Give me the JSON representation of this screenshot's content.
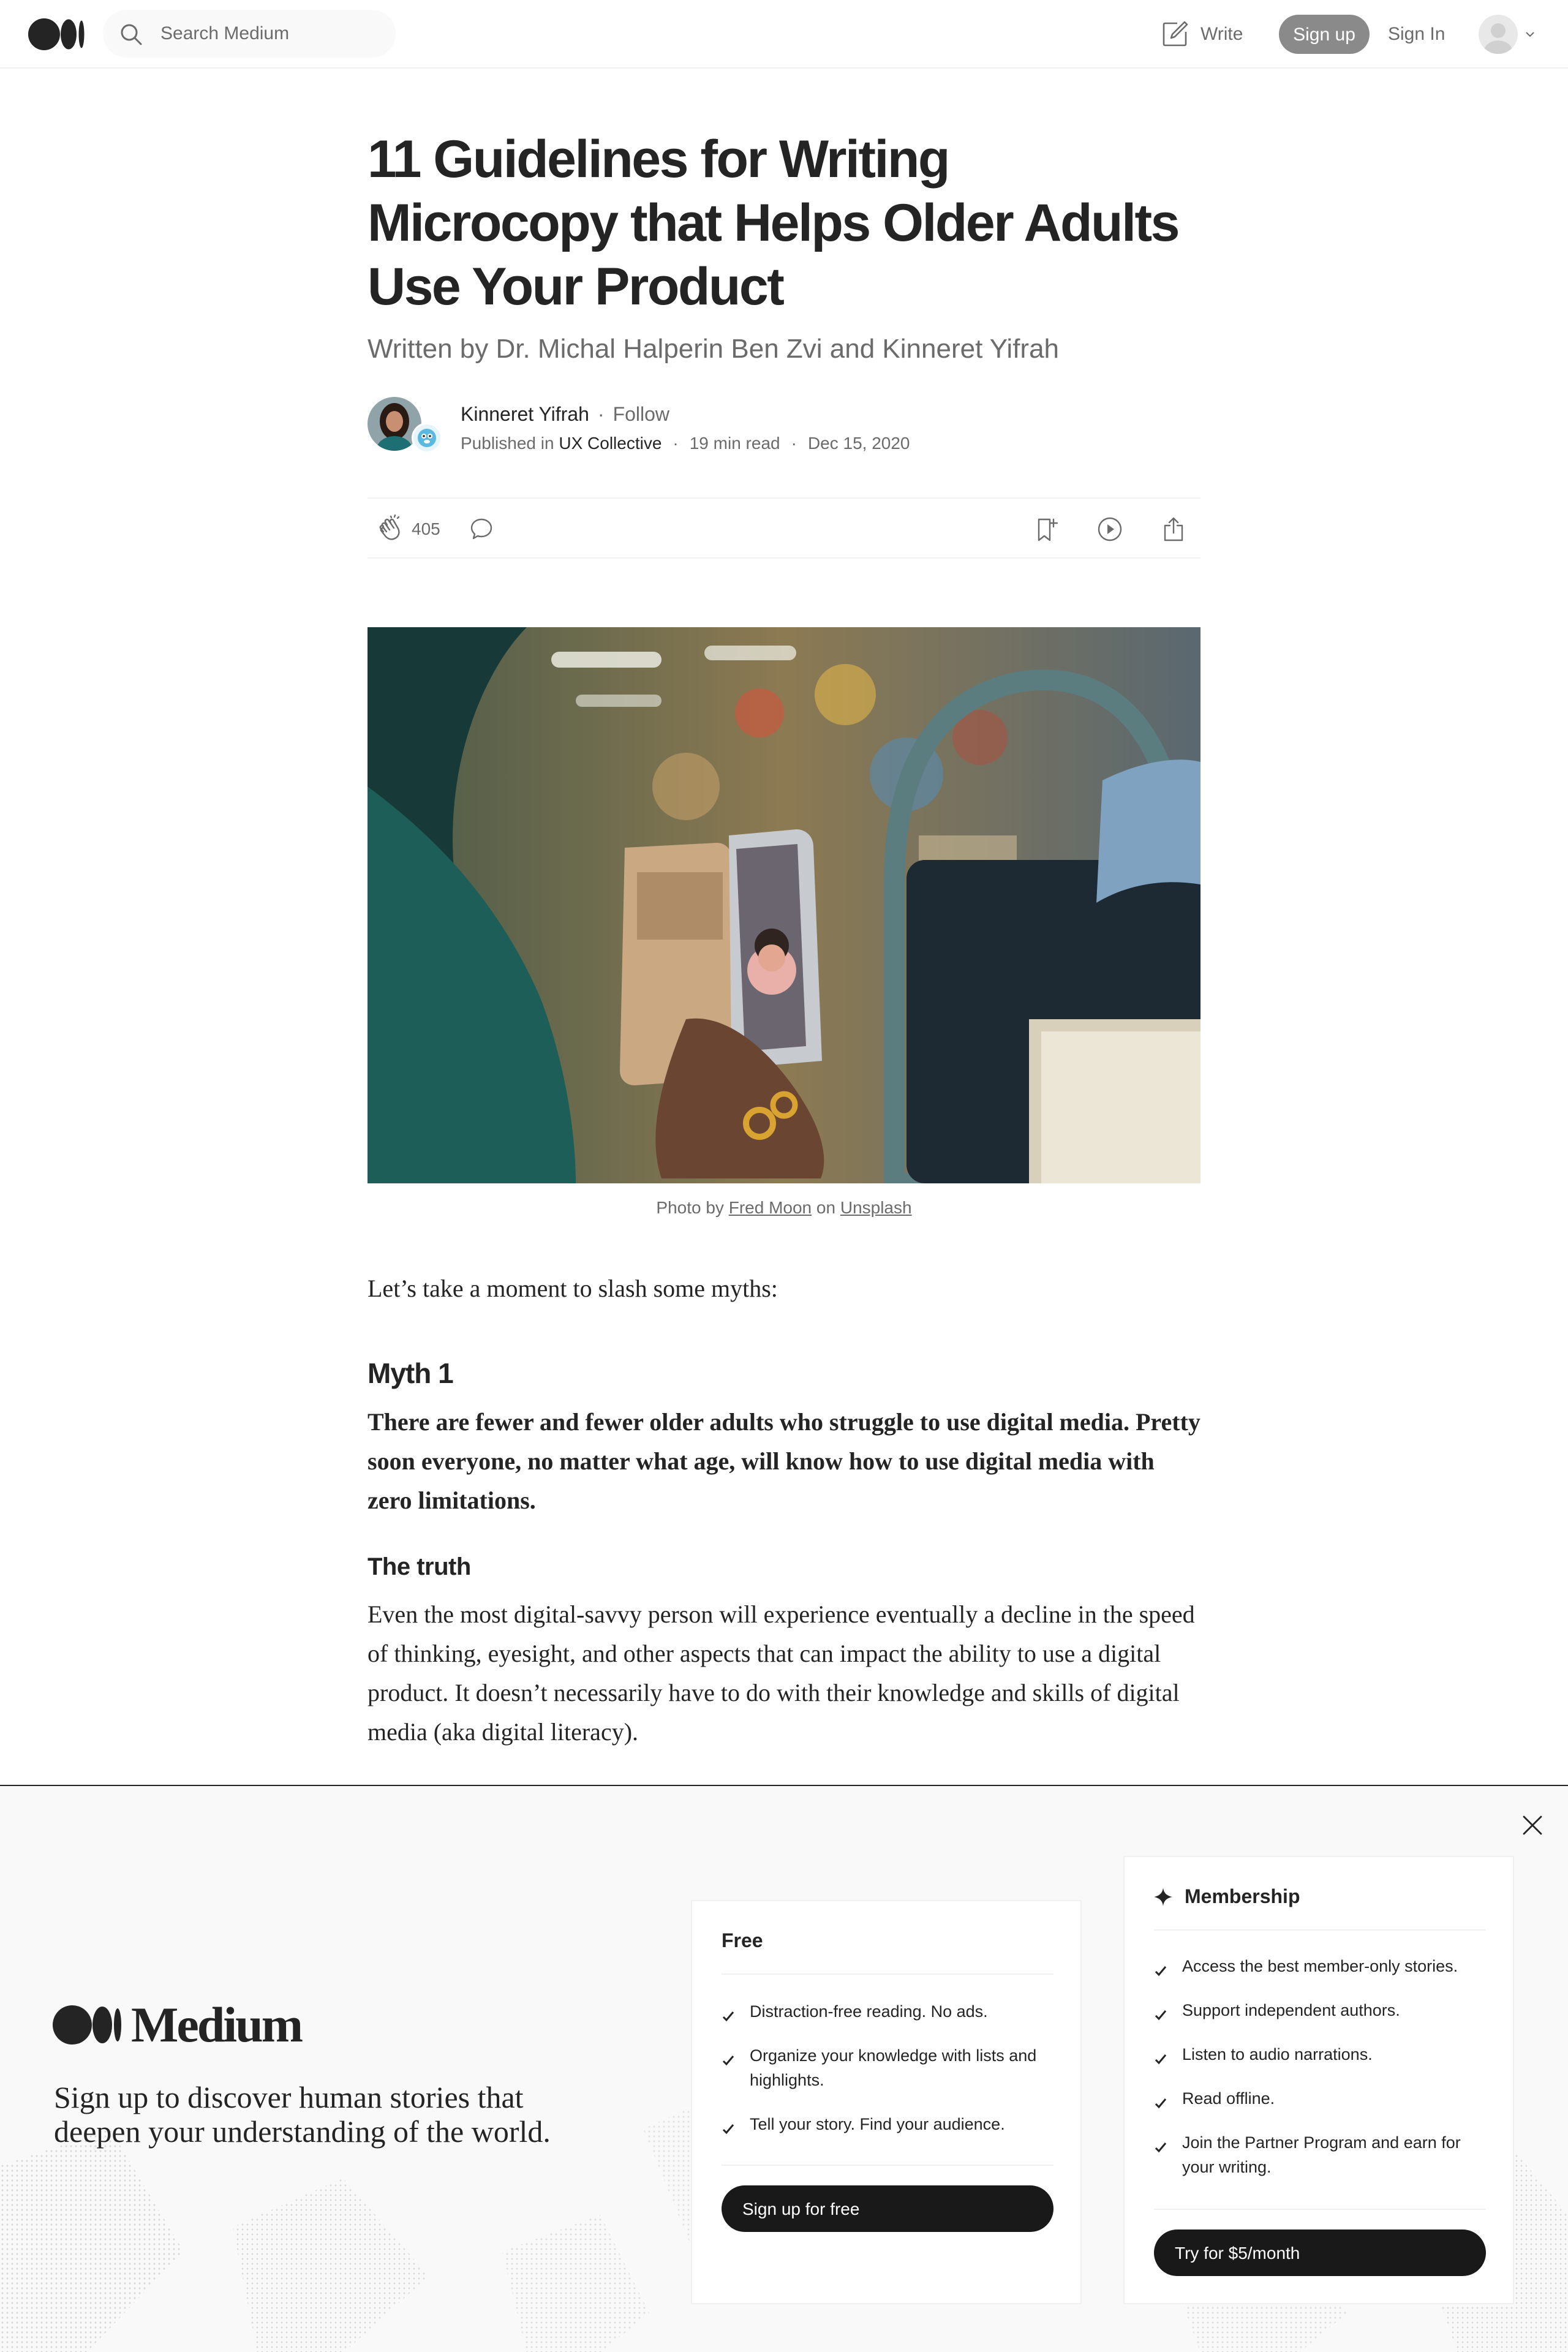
{
  "nav": {
    "search_placeholder": "Search Medium",
    "write_label": "Write",
    "signup_label": "Sign up",
    "signin_label": "Sign In"
  },
  "article": {
    "title": "11 Guidelines for Writing Microcopy that Helps Older Adults Use Your Product",
    "subtitle": "Written by Dr. Michal Halperin Ben Zvi and Kinneret Yifrah",
    "author_name": "Kinneret Yifrah",
    "follow_label": "Follow",
    "published_in_label": "Published in",
    "publication": "UX Collective",
    "read_time": "19 min read",
    "date": "Dec 15, 2020",
    "claps": "405",
    "caption_prefix": "Photo by",
    "caption_photographer": "Fred Moon",
    "caption_on": "on",
    "caption_source": "Unsplash",
    "intro": "Let’s take a moment to slash some myths:",
    "myth_heading": "Myth 1",
    "myth_text": "There are fewer and fewer older adults who struggle to use digital media. Pretty soon everyone, no matter what age, will know how to use digital media with zero limitations.",
    "truth_heading": "The truth",
    "truth_text": "Even the most digital-savvy person will experience eventually a decline in the speed of thinking, eyesight, and other aspects that can impact the ability to use a digital product. It doesn’t necessarily have to do with their knowledge and skills of digital media (aka digital literacy)."
  },
  "signup_overlay": {
    "brand": "Medium",
    "tagline": "Sign up to discover human stories that deepen your understanding of the world.",
    "free": {
      "heading": "Free",
      "features": [
        "Distraction-free reading. No ads.",
        "Organize your knowledge with lists and highlights.",
        "Tell your story. Find your audience."
      ],
      "button": "Sign up for free"
    },
    "membership": {
      "heading": "Membership",
      "features": [
        "Access the best member-only stories.",
        "Support independent authors.",
        "Listen to audio narrations.",
        "Read offline.",
        "Join the Partner Program and earn for your writing."
      ],
      "button": "Try for $5/month"
    }
  },
  "icons": {
    "logo": "medium-logo-icon",
    "search": "search-icon",
    "write": "write-icon",
    "clap": "clap-icon",
    "comment": "comment-icon",
    "bookmark": "bookmark-icon",
    "play": "play-icon",
    "share": "share-icon",
    "close": "close-icon",
    "check": "check-icon",
    "membership": "sparkle-icon"
  },
  "colors": {
    "text": "#242424",
    "muted": "#6b6b6b",
    "signup_button": "#8a8a8a",
    "dark_button": "#191919",
    "overlay_bg": "#f9f9f9"
  }
}
